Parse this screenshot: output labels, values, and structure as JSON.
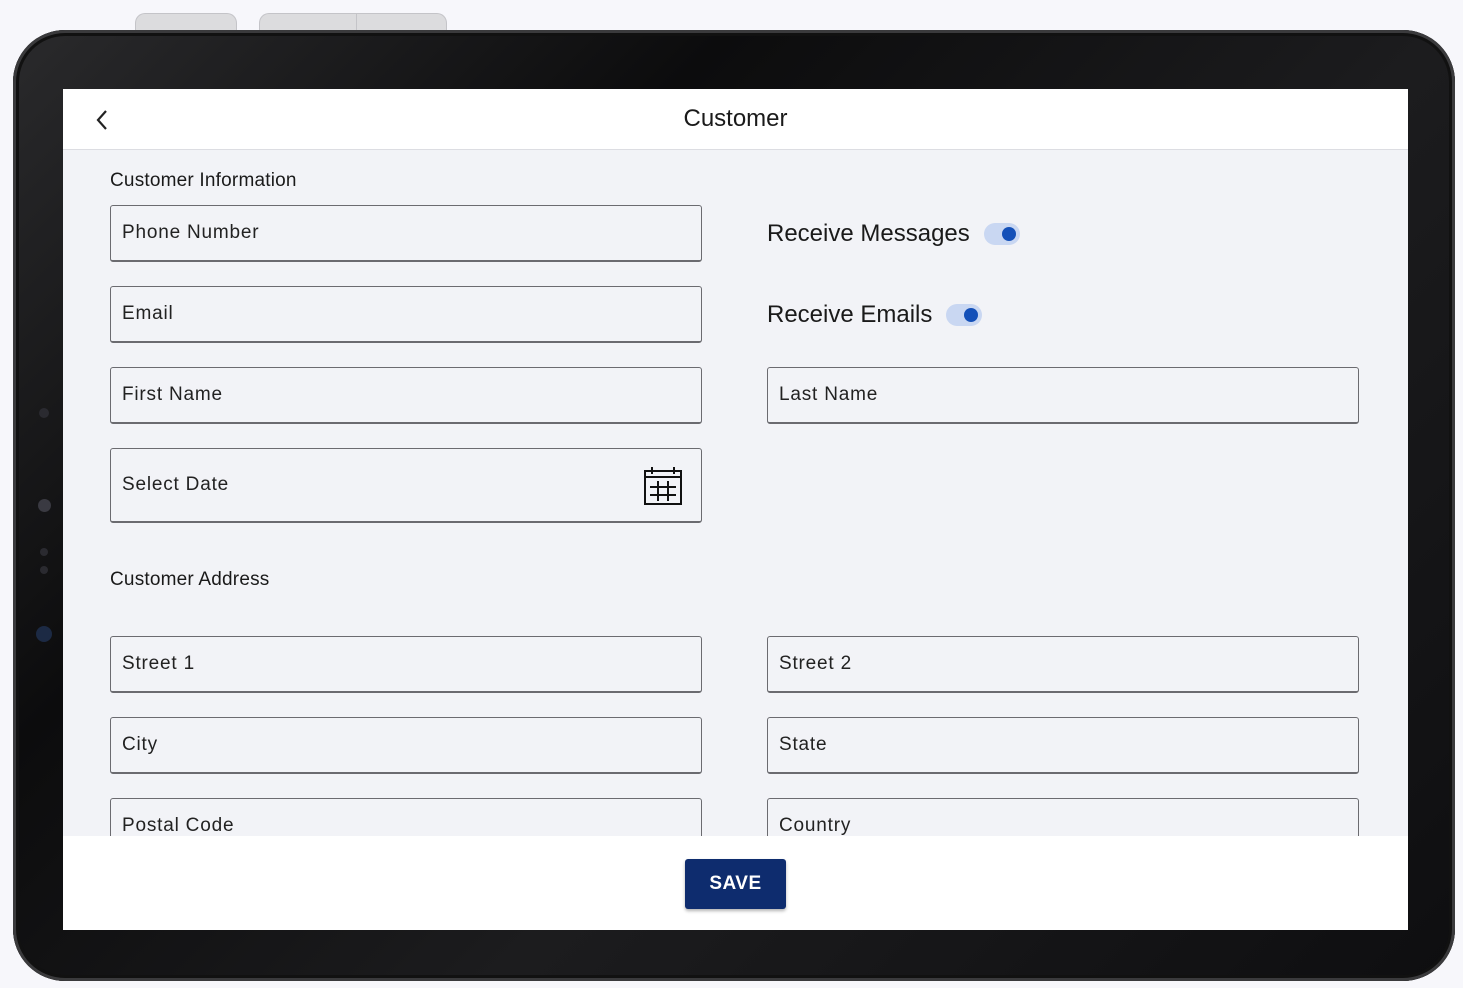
{
  "appbar": {
    "title": "Customer",
    "back_icon": "chevron-left-icon"
  },
  "customer_information": {
    "section_title": "Customer Information",
    "phone_number_label": "Phone Number",
    "email_label": "Email",
    "first_name_label": "First Name",
    "last_name_label": "Last Name",
    "date_label": "Select Date",
    "calendar_icon": "calendar-icon",
    "receive_messages": {
      "label": "Receive Messages",
      "on": true
    },
    "receive_emails": {
      "label": "Receive Emails",
      "on": true
    }
  },
  "customer_address": {
    "section_title": "Customer Address",
    "street1_label": "Street 1",
    "street2_label": "Street 2",
    "city_label": "City",
    "state_label": "State",
    "postal_code_label": "Postal Code",
    "country_label": "Country"
  },
  "footer": {
    "save_label": "SAVE"
  },
  "colors": {
    "accent": "#0e2c6e",
    "toggle_knob": "#1450b8",
    "toggle_track": "#c9d7f2"
  }
}
